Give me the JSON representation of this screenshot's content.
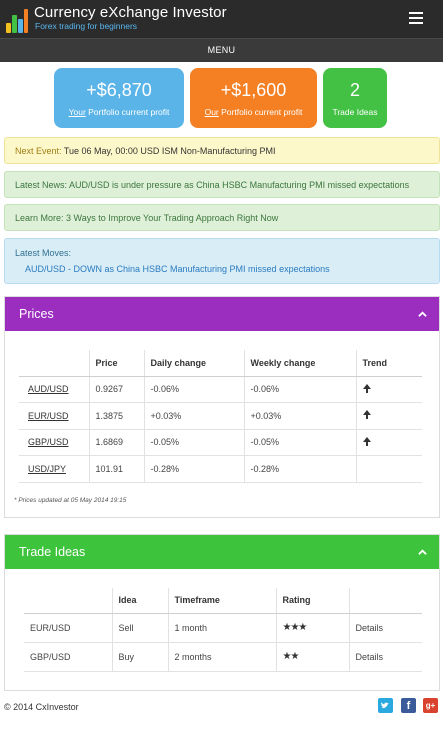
{
  "header": {
    "title": "Currency eXchange Investor",
    "subtitle": "Forex trading for beginners",
    "menu_label": "MENU"
  },
  "cards": {
    "your_value": "+$6,870",
    "your_prefix": "Your",
    "your_suffix": " Portfolio current profit",
    "our_value": "+$1,600",
    "our_prefix": "Our",
    "our_suffix": " Portfolio current profit",
    "ideas_count": "2",
    "ideas_label": "Trade Ideas"
  },
  "alerts": {
    "next_event_label": "Next Event:",
    "next_event_text": " Tue 06 May, 00:00 USD ISM Non-Manufacturing PMI",
    "latest_news_label": "Latest News:",
    "latest_news_text": " AUD/USD is under pressure as China HSBC Manufacturing PMI missed expectations",
    "learn_more_label": "Learn More:",
    "learn_more_text": " 3 Ways to Improve Your Trading Approach Right Now",
    "latest_moves_label": "Latest Moves:",
    "latest_moves_text": "AUD/USD  - DOWN as China HSBC Manufacturing PMI missed expectations"
  },
  "prices": {
    "title": "Prices",
    "columns": [
      "",
      "Price",
      "Daily change",
      "Weekly change",
      "Trend"
    ],
    "rows": [
      {
        "pair": "AUD/USD",
        "price": "0.9267",
        "daily": "-0.06%",
        "weekly": "-0.06%",
        "trend": "up"
      },
      {
        "pair": "EUR/USD",
        "price": "1.3875",
        "daily": "+0.03%",
        "weekly": "+0.03%",
        "trend": "up"
      },
      {
        "pair": "GBP/USD",
        "price": "1.6869",
        "daily": "-0.05%",
        "weekly": "-0.05%",
        "trend": "up"
      },
      {
        "pair": "USD/JPY",
        "price": "101.91",
        "daily": "-0.28%",
        "weekly": "-0.28%",
        "trend": ""
      }
    ],
    "footnote": "* Prices updated at 05 May 2014 19:15"
  },
  "trade_ideas": {
    "title": "Trade Ideas",
    "columns": [
      "",
      "Idea",
      "Timeframe",
      "Rating",
      ""
    ],
    "rows": [
      {
        "pair": "EUR/USD",
        "idea": "Sell",
        "timeframe": "1 month",
        "rating": "★★★",
        "action": "Details"
      },
      {
        "pair": "GBP/USD",
        "idea": "Buy",
        "timeframe": "2 months",
        "rating": "★★",
        "action": "Details"
      }
    ]
  },
  "footer": {
    "copyright": "© 2014 CxInvestor",
    "social": [
      "twitter-icon",
      "facebook-icon",
      "google-plus-icon"
    ]
  },
  "colors": {
    "topbar": "#2b2b2b",
    "card_blue": "#5ab4e8",
    "card_orange": "#f57f23",
    "card_green": "#43c144",
    "prices_header": "#9b2dbf",
    "ideas_header": "#3ec43c"
  }
}
